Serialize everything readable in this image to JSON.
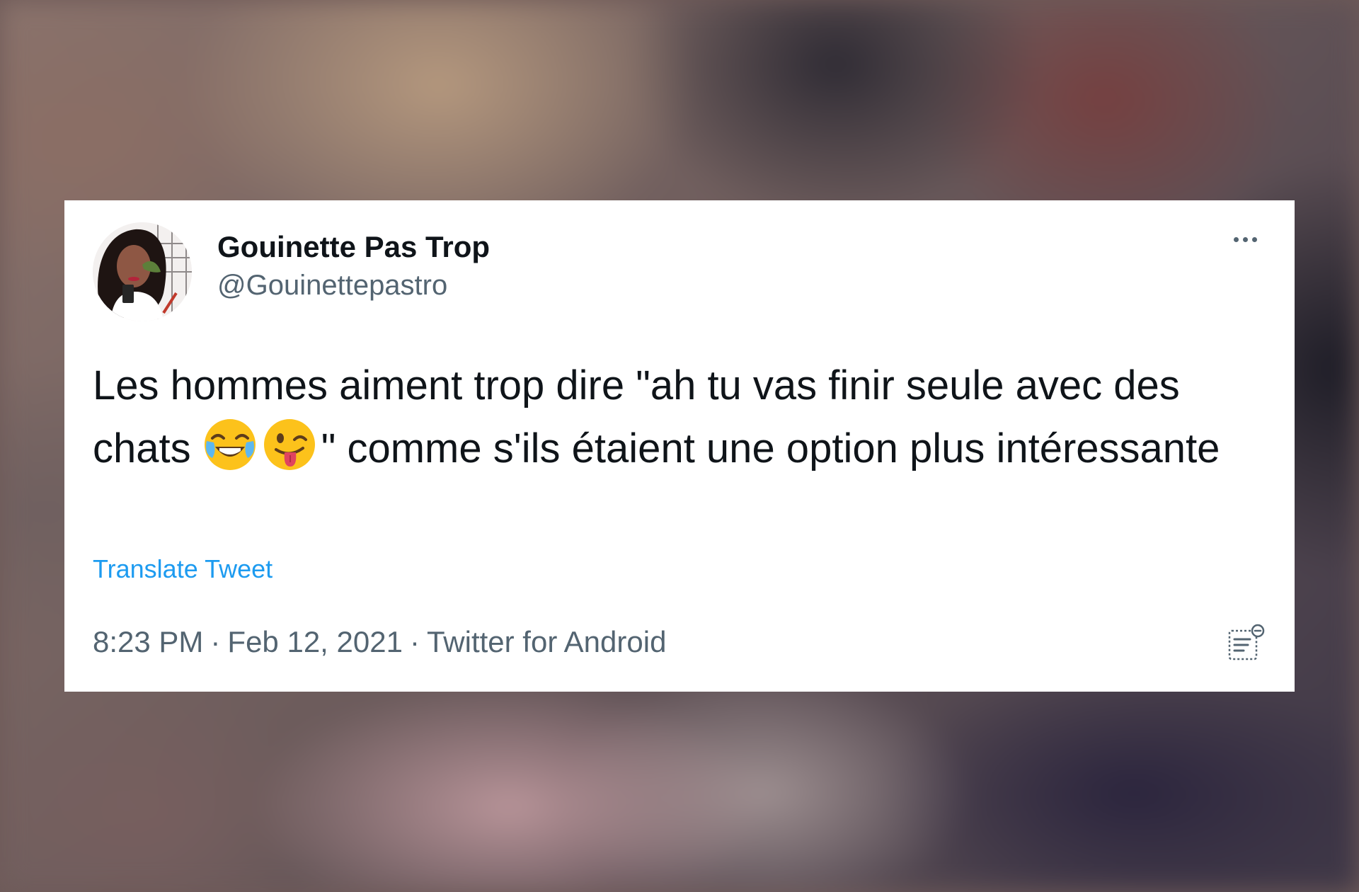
{
  "tweet": {
    "display_name": "Gouinette Pas Trop",
    "handle": "@Gouinettepastro",
    "text_before_emoji": "Les hommes aiment trop dire \"ah tu vas finir seule avec des chats ",
    "emojis": [
      "face-with-tears-of-joy",
      "winking-face-with-tongue"
    ],
    "text_after_emoji": "\" comme s'ils étaient une option plus intéressante",
    "translate_label": "Translate Tweet",
    "time": "8:23 PM",
    "date": "Feb 12, 2021",
    "source": "Twitter for Android",
    "separator": "·"
  },
  "icons": {
    "more": "more-horizontal-icon",
    "analytics": "tweet-analytics-icon"
  },
  "colors": {
    "card_background": "#ffffff",
    "primary_text": "#0f1419",
    "secondary_text": "#536471",
    "link": "#1d9bf0"
  }
}
